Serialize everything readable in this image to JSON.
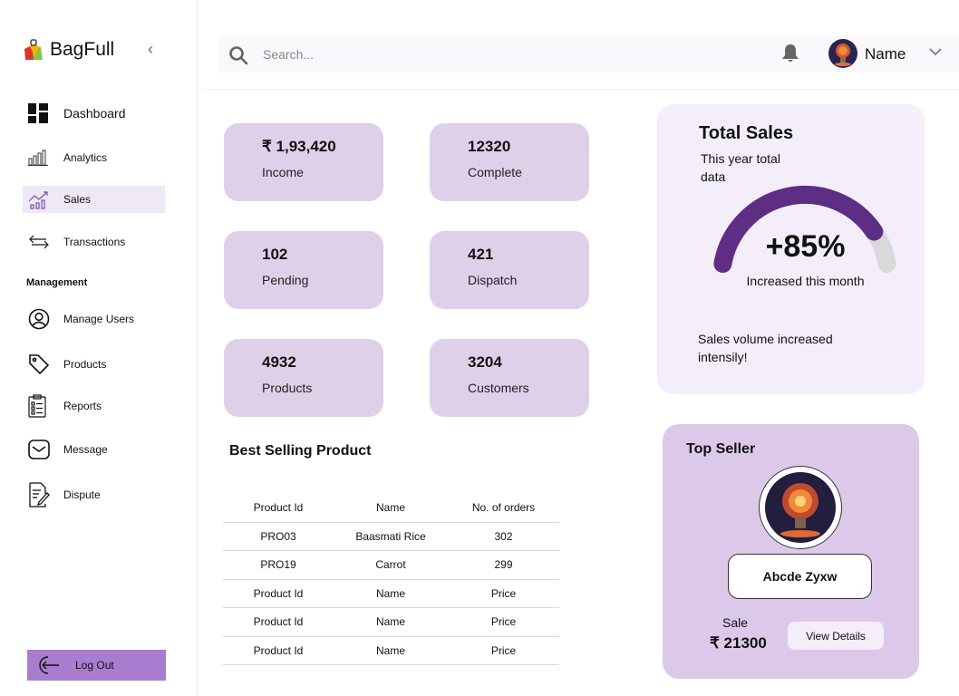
{
  "app": {
    "name": "BagFull"
  },
  "sidebar": {
    "collapse_glyph": "‹",
    "items": [
      {
        "label": "Dashboard",
        "icon": "dashboard-icon"
      },
      {
        "label": "Analytics",
        "icon": "analytics-icon"
      },
      {
        "label": "Sales",
        "icon": "sales-icon",
        "active": true
      },
      {
        "label": "Transactions",
        "icon": "transactions-icon"
      }
    ],
    "management_label": "Management",
    "management_items": [
      {
        "label": "Manage Users",
        "icon": "user-circle-icon"
      },
      {
        "label": "Products",
        "icon": "tag-icon"
      },
      {
        "label": "Reports",
        "icon": "clipboard-icon"
      },
      {
        "label": "Message",
        "icon": "mail-icon"
      },
      {
        "label": "Dispute",
        "icon": "document-edit-icon"
      }
    ],
    "logout_label": "Log Out"
  },
  "header": {
    "search_placeholder": "Search...",
    "user_name": "Name"
  },
  "stats": [
    {
      "value": "₹ 1,93,420",
      "label": "Income"
    },
    {
      "value": "12320",
      "label": "Complete"
    },
    {
      "value": "102",
      "label": "Pending"
    },
    {
      "value": "421",
      "label": "Dispatch"
    },
    {
      "value": "4932",
      "label": "Products"
    },
    {
      "value": "3204",
      "label": "Customers"
    }
  ],
  "total_sales": {
    "title": "Total Sales",
    "subtitle": "This year total data",
    "percent_text": "+85%",
    "percent_value": 85,
    "caption": "Increased this month",
    "note": "Sales volume increased intensily!"
  },
  "best_selling": {
    "title": "Best Selling Product",
    "columns": [
      "Product Id",
      "Name",
      "No. of orders"
    ],
    "rows": [
      [
        "PRO03",
        "Baasmati Rice",
        "302"
      ],
      [
        "PRO19",
        "Carrot",
        "299"
      ],
      [
        "Product Id",
        "Name",
        "Price"
      ],
      [
        "Product Id",
        "Name",
        "Price"
      ],
      [
        "Product Id",
        "Name",
        "Price"
      ]
    ]
  },
  "top_seller": {
    "title": "Top Seller",
    "name": "Abcde Zyxw",
    "sale_label": "Sale",
    "sale_value": "₹ 21300",
    "view_label": "View Details"
  },
  "colors": {
    "accent": "#5e2d84",
    "card": "#dfd0ea",
    "logout": "#a87ccf",
    "gauge_track": "#d9d9d9"
  }
}
